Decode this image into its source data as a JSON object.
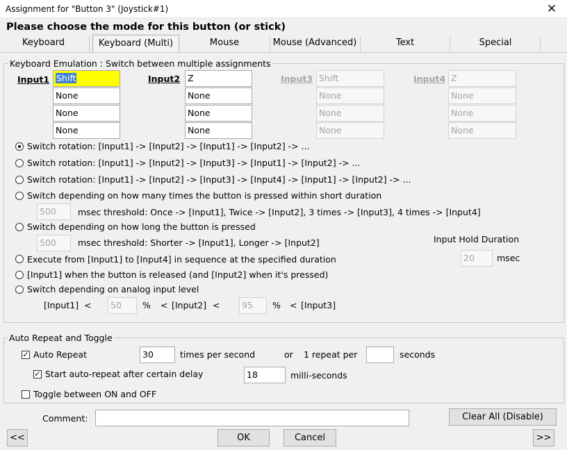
{
  "window": {
    "title": "Assignment for \"Button 3\" (Joystick#1)",
    "close_glyph": "✕"
  },
  "heading": "Please choose the mode for this button (or stick)",
  "tabs": [
    "Keyboard",
    "Keyboard (Multi)",
    "Mouse",
    "Mouse (Advanced)",
    "Text",
    "Special"
  ],
  "emulation": {
    "legend": "Keyboard Emulation : Switch between multiple assignments",
    "inputs": [
      {
        "label": "Input1",
        "values": [
          "Shift",
          "None",
          "None",
          "None"
        ]
      },
      {
        "label": "Input2",
        "values": [
          "Z",
          "None",
          "None",
          "None"
        ]
      },
      {
        "label": "Input3",
        "values": [
          "Shift",
          "None",
          "None",
          "None"
        ]
      },
      {
        "label": "Input4",
        "values": [
          "Z",
          "None",
          "None",
          "None"
        ]
      }
    ],
    "options": [
      "Switch rotation: [Input1] -> [Input2] -> [Input1] -> [Input2] -> ...",
      "Switch rotation: [Input1] -> [Input2] -> [Input3] -> [Input1] -> [Input2] -> ...",
      "Switch rotation: [Input1] -> [Input2] -> [Input3] -> [Input4] -> [Input1] -> [Input2] -> ...",
      "Switch depending on how many times the button is pressed within short duration",
      "Switch depending on how long the button is pressed",
      "Execute from [Input1] to [Input4] in sequence at the specified duration",
      "[Input1] when the button is released (and [Input2] when it's pressed)",
      "Switch depending on analog input level"
    ],
    "selected_option": 0,
    "count_threshold": {
      "value": "500",
      "text": "msec threshold: Once -> [Input1], Twice -> [Input2], 3 times -> [Input3], 4 times -> [Input4]"
    },
    "long_threshold": {
      "value": "500",
      "text": "msec threshold: Shorter -> [Input1], Longer -> [Input2]"
    },
    "hold": {
      "label": "Input Hold Duration",
      "value": "20",
      "unit": "msec"
    },
    "analog": {
      "input1": "[Input1]",
      "lt1": "<",
      "v1": "50",
      "pct1": "%",
      "lt2": "<",
      "input2": "[Input2]",
      "lt3": "<",
      "v2": "95",
      "pct2": "%",
      "lt4": "<",
      "input3": "[Input3]"
    }
  },
  "auto_repeat": {
    "legend": "Auto Repeat and Toggle",
    "auto_repeat_label": "Auto Repeat",
    "auto_repeat_checked": true,
    "times_value": "30",
    "times_label": "times per second",
    "or_label": "or",
    "repeat_per_label": "1 repeat per",
    "seconds_value": "",
    "seconds_label": "seconds",
    "delay_label": "Start auto-repeat after certain delay",
    "delay_checked": true,
    "delay_value": "18",
    "delay_unit": "milli-seconds",
    "toggle_label": "Toggle between ON and OFF",
    "toggle_checked": false
  },
  "footer": {
    "comment_label": "Comment:",
    "comment_value": "",
    "clear_all": "Clear All (Disable)",
    "prev": "<<",
    "ok": "OK",
    "cancel": "Cancel",
    "next": ">>"
  }
}
